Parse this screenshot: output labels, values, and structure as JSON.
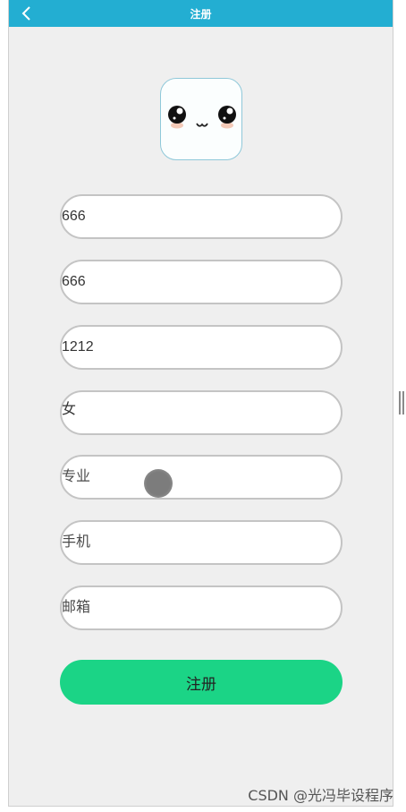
{
  "header": {
    "title": "注册",
    "back_icon": "chevron-left-icon",
    "color": "#23aed2"
  },
  "avatar": {
    "icon": "cute-face-icon"
  },
  "form": {
    "fields": [
      {
        "name": "username",
        "value": "666",
        "placeholder": ""
      },
      {
        "name": "password",
        "value": "666",
        "placeholder": ""
      },
      {
        "name": "class",
        "value": "1212",
        "placeholder": ""
      },
      {
        "name": "gender",
        "value": "女",
        "placeholder": ""
      },
      {
        "name": "major",
        "value": "",
        "placeholder": "专业"
      },
      {
        "name": "phone",
        "value": "",
        "placeholder": "手机"
      },
      {
        "name": "email",
        "value": "",
        "placeholder": "邮箱"
      }
    ],
    "submit_label": "注册",
    "submit_color": "#1bd486"
  },
  "watermark": "CSDN @光冯毕设程序"
}
